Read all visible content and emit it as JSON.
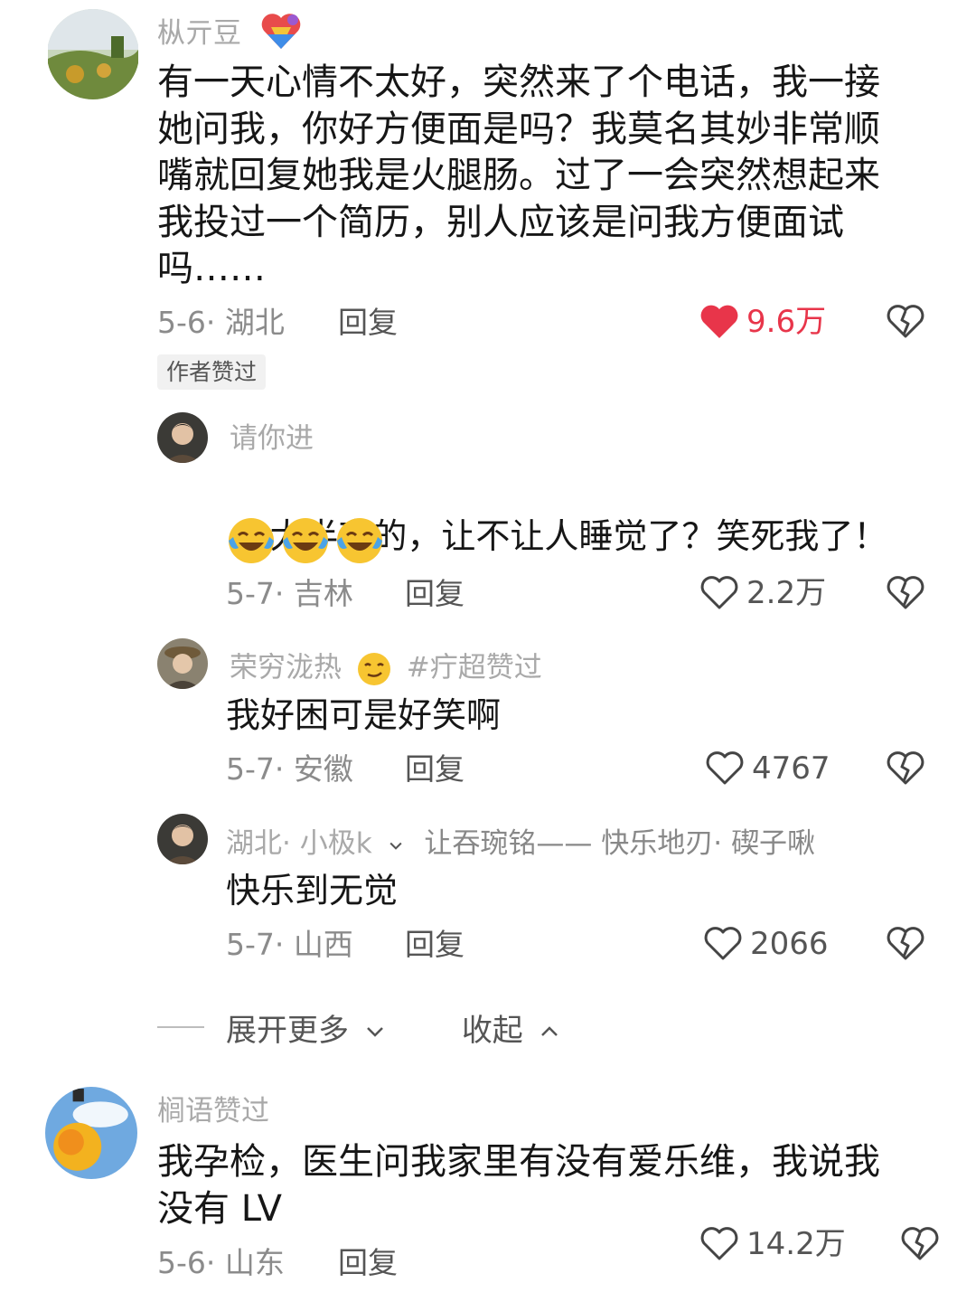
{
  "comments": [
    {
      "username": "枞亓豆",
      "body": "有一天心情不太好，突然来了个电话，我一接\n她问我，你好方便面是吗？我莫名其妙非常顺\n嘴就回复她我是火腿肠。过了一会突然想起来\n我投过一个简历，别人应该是问我方便面试\n吗……",
      "meta": "5-6· 湖北",
      "reply_label": "回复",
      "likes": "9.6万",
      "liked": true,
      "author_badge": "作者赞过",
      "replies": [
        {
          "username": "请你进",
          "body": "大半夜的，让不让人睡觉了？笑死我了！",
          "emoji": [
            "laughing-tears-emoji",
            "laughing-tears-emoji",
            "laughing-tears-emoji"
          ],
          "meta": "5-7· 吉林",
          "reply_label": "回复",
          "likes": "2.2万"
        },
        {
          "username": "荣穷泷热",
          "tag": "#疔超赞过",
          "body": "我好困可是好笑啊",
          "meta": "5-7· 安徽",
          "reply_label": "回复",
          "likes": "4767"
        },
        {
          "username": "湖北· 小极k",
          "reply_to": "让吞琬铭—— 快乐地刃· 碶子啾",
          "body": "快乐到无觉",
          "meta": "5-7· 山西",
          "reply_label": "回复",
          "likes": "2066"
        }
      ]
    },
    {
      "username": "榈语赞过",
      "body": "我孕检，医生问我家里有没有爱乐维，我说我\n没有 LV",
      "meta": "5-6· 山东",
      "reply_label": "回复",
      "likes": "14.2万",
      "liked": false
    }
  ],
  "thread_controls": {
    "expand_more": "展开更多",
    "collapse": "收起"
  },
  "colors": {
    "liked_red": "#e8354a",
    "meta_gray": "#8b8b8b",
    "username_gray": "#a9a9a9"
  }
}
